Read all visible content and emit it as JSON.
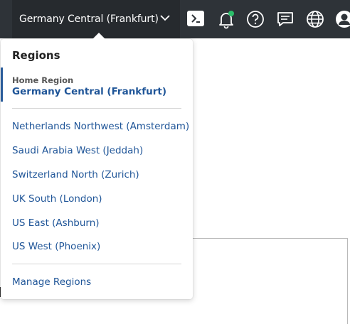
{
  "topbar": {
    "region_selector_label": "Germany Central (Frankfurt)",
    "icons": [
      "cloud-shell-icon",
      "bell-icon",
      "help-icon",
      "chat-icon",
      "globe-icon",
      "user-icon"
    ],
    "notification_dot_color": "#2bbf6a"
  },
  "regions_menu": {
    "title": "Regions",
    "home_region_label": "Home Region",
    "home_region_name": "Germany Central (Frankfurt)",
    "regions": [
      "Netherlands Northwest (Amsterdam)",
      "Saudi Arabia West (Jeddah)",
      "Switzerland North (Zurich)",
      "UK South (London)",
      "US East (Ashburn)",
      "US West (Phoenix)"
    ],
    "manage_link": "Manage Regions"
  },
  "colors": {
    "topbar_bg": "#2e3338",
    "link": "#1f5598",
    "accent_bar": "#2a5c9a"
  }
}
